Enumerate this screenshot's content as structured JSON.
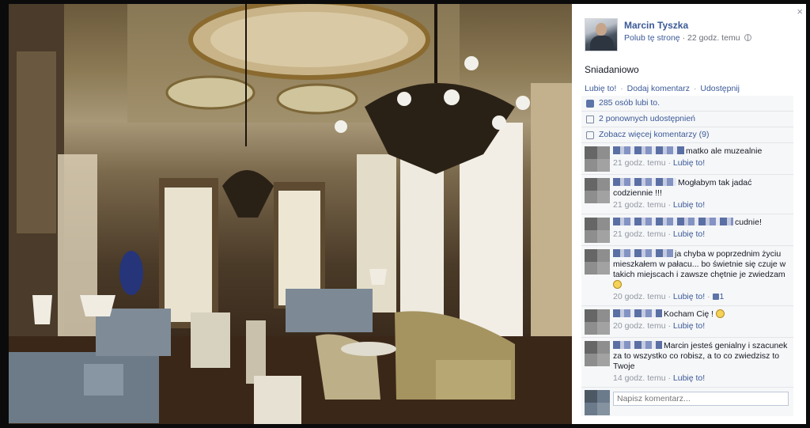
{
  "post": {
    "author": "Marcin Tyszka",
    "like_page": "Polub tę stronę",
    "separator": "·",
    "time": "22 godz. temu",
    "text": "Sniadaniowo",
    "actions": {
      "like": "Lubię to!",
      "comment": "Dodaj komentarz",
      "share": "Udostępnij",
      "separator": "·"
    }
  },
  "ufi": {
    "likes": "285 osób lubi to.",
    "shares": "2 ponownych udostępnień",
    "more_comments": "Zobacz więcej komentarzy (9)"
  },
  "comments": [
    {
      "text": "matko ale muzealnie",
      "time": "21 godz. temu",
      "like": "Lubię to!",
      "likes": ""
    },
    {
      "text": "Mogłabym tak jadać codziennie !!!",
      "time": "21 godz. temu",
      "like": "Lubię to!",
      "likes": ""
    },
    {
      "text": "cudnie!",
      "time": "21 godz. temu",
      "like": "Lubię to!",
      "likes": ""
    },
    {
      "text": "ja chyba w poprzednim życiu mieszkałem w pałacu... bo świetnie się czuje w takich miejscach i zawsze chętnie je zwiedzam",
      "time": "20 godz. temu",
      "like": "Lubię to!",
      "likes": "1"
    },
    {
      "text": "Kocham Cię !",
      "time": "20 godz. temu",
      "like": "Lubię to!",
      "likes": ""
    },
    {
      "text": "Marcin jesteś genialny i szacunek za to wszystko co robisz, a to co zwiedzisz to Twoje",
      "time": "14 godz. temu",
      "like": "Lubię to!",
      "likes": ""
    }
  ],
  "comment_box": {
    "placeholder": "Napisz komentarz..."
  },
  "close_label": "×",
  "icons": [
    "close-icon",
    "globe-icon",
    "like-thumb-icon",
    "share-icon",
    "comment-icon",
    "smiley-icon"
  ]
}
